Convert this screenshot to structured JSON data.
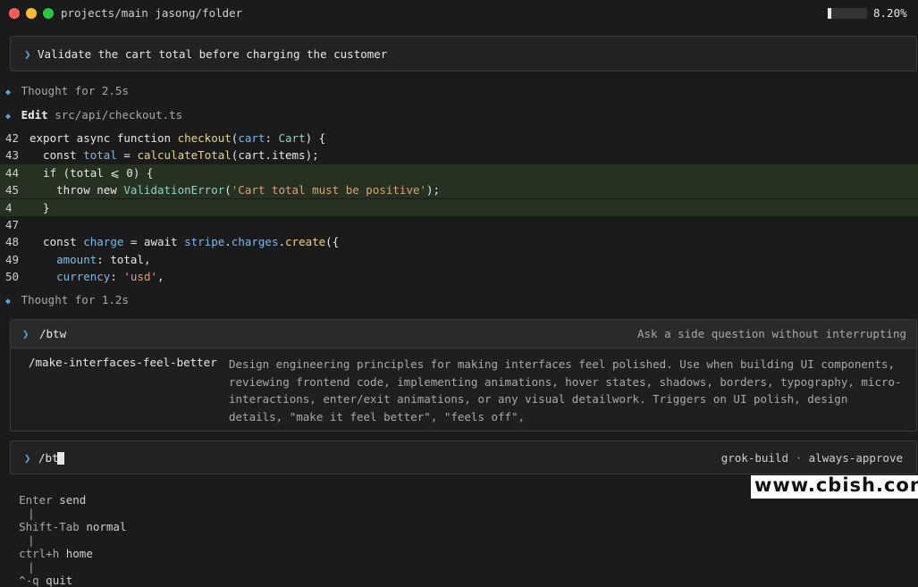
{
  "window": {
    "title": "projects/main jasong/folder",
    "usage_percent": "8.20%",
    "usage_fraction": 0.082,
    "traffic_lights": [
      "#ff5f57",
      "#febc2e",
      "#28c840"
    ]
  },
  "prompt": {
    "chevron": "❯",
    "text": "Validate the cart total before charging the customer"
  },
  "thought1": {
    "icon": "◆",
    "text": "Thought for 2.5s"
  },
  "edit": {
    "icon": "◆",
    "label": "Edit",
    "path": "src/api/checkout.ts"
  },
  "code": {
    "lines": [
      {
        "num": "42",
        "tokens": [
          [
            "pl",
            "export async function "
          ],
          [
            "fn",
            "checkout"
          ],
          [
            "pl",
            "("
          ],
          [
            "vr",
            "cart"
          ],
          [
            "pl",
            ": "
          ],
          [
            "ty",
            "Cart"
          ],
          [
            "pl",
            ") {"
          ]
        ],
        "highlight": false
      },
      {
        "num": "43",
        "tokens": [
          [
            "pl",
            "  const "
          ],
          [
            "vr",
            "total"
          ],
          [
            "pl",
            " = "
          ],
          [
            "fn",
            "calculateTotal"
          ],
          [
            "pl",
            "(cart.items);"
          ]
        ],
        "highlight": false
      },
      {
        "num": "44",
        "tokens": [
          [
            "pl",
            "  if (total ⩽ 0) {"
          ]
        ],
        "highlight": true
      },
      {
        "num": "45",
        "tokens": [
          [
            "pl",
            "    throw new "
          ],
          [
            "ty",
            "ValidationError"
          ],
          [
            "pl",
            "("
          ],
          [
            "str",
            "'Cart total must be positive'"
          ],
          [
            "pl",
            ");"
          ]
        ],
        "highlight": true
      },
      {
        "num": "4",
        "tokens": [
          [
            "pl",
            "  }"
          ]
        ],
        "highlight": true
      },
      {
        "num": "47",
        "tokens": [],
        "highlight": false
      },
      {
        "num": "48",
        "tokens": [
          [
            "pl",
            "  const "
          ],
          [
            "vr",
            "charge"
          ],
          [
            "pl",
            " = await "
          ],
          [
            "vr",
            "stripe"
          ],
          [
            "pl",
            "."
          ],
          [
            "vr",
            "charges"
          ],
          [
            "pl",
            "."
          ],
          [
            "fn",
            "create"
          ],
          [
            "pl",
            "({"
          ]
        ],
        "highlight": false
      },
      {
        "num": "49",
        "tokens": [
          [
            "pl",
            "    "
          ],
          [
            "vr",
            "amount"
          ],
          [
            "pl",
            ": total,"
          ]
        ],
        "highlight": false
      },
      {
        "num": "50",
        "tokens": [
          [
            "pl",
            "    "
          ],
          [
            "vr",
            "currency"
          ],
          [
            "pl",
            ": "
          ],
          [
            "str",
            "'usd'"
          ],
          [
            "pl",
            ","
          ]
        ],
        "highlight": false
      }
    ]
  },
  "thought2": {
    "icon": "◆",
    "text": "Thought for 1.2s"
  },
  "palette": {
    "chevron": "❯",
    "query": "/btw",
    "hint": "Ask a side question without interrupting",
    "suggestion": {
      "command": "/make-interfaces-feel-better",
      "description_lines": [
        "Design engineering principles for making interfaces feel polished. Use when building UI components,",
        "reviewing frontend code, implementing animations, hover states, shadows, borders, typography, micro-",
        "interactions, enter/exit animations, or any visual detailwork. Triggers on UI polish, design",
        "details, \"make it feel better\", \"feels off\","
      ]
    }
  },
  "input": {
    "chevron": "❯",
    "value": "/bt",
    "model": "grok-build",
    "separator": "·",
    "mode": "always-approve"
  },
  "footer": {
    "items": [
      {
        "key": "Enter",
        "action": "send"
      },
      {
        "key": "Shift-Tab",
        "action": "normal"
      },
      {
        "key": "ctrl+h",
        "action": "home"
      },
      {
        "key": "^-q",
        "action": "quit"
      }
    ],
    "separator": "|"
  },
  "watermark": "www.cbish.com"
}
